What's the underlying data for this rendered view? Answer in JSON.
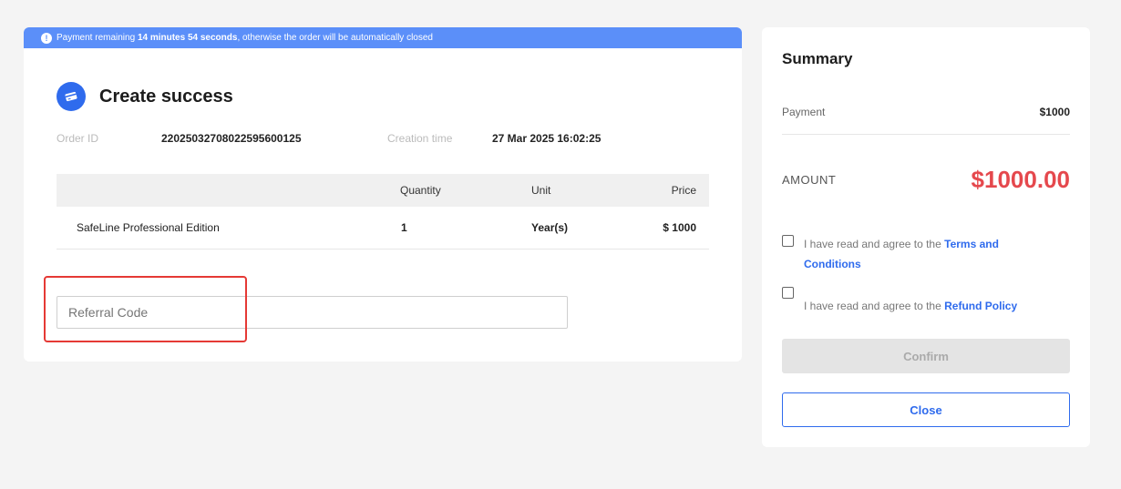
{
  "banner": {
    "prefix": "Payment remaining ",
    "countdown": "14 minutes 54 seconds",
    "suffix": ", otherwise the order will be automatically closed"
  },
  "order": {
    "title": "Create success",
    "id_label": "Order ID",
    "id_value": "2202503270802259560012​5",
    "time_label": "Creation time",
    "time_value": "27 Mar 2025 16:02:25"
  },
  "table": {
    "headers": {
      "quantity": "Quantity",
      "unit": "Unit",
      "price": "Price"
    },
    "rows": [
      {
        "product": "SafeLine Professional Edition",
        "quantity": "1",
        "unit": "Year(s)",
        "price": "$ 1000"
      }
    ]
  },
  "referral": {
    "placeholder": "Referral Code"
  },
  "summary": {
    "title": "Summary",
    "payment_label": "Payment",
    "payment_value": "$1000",
    "amount_label": "AMOUNT",
    "amount_value": "$1000.00",
    "agree_prefix": "I have read and agree to the ",
    "terms_link": "Terms and Conditions",
    "refund_link": "Refund Policy",
    "confirm_label": "Confirm",
    "close_label": "Close"
  },
  "colors": {
    "accent": "#2f6bed",
    "banner": "#5b8ff9",
    "amount": "#e5484d",
    "highlight": "#e53935"
  }
}
